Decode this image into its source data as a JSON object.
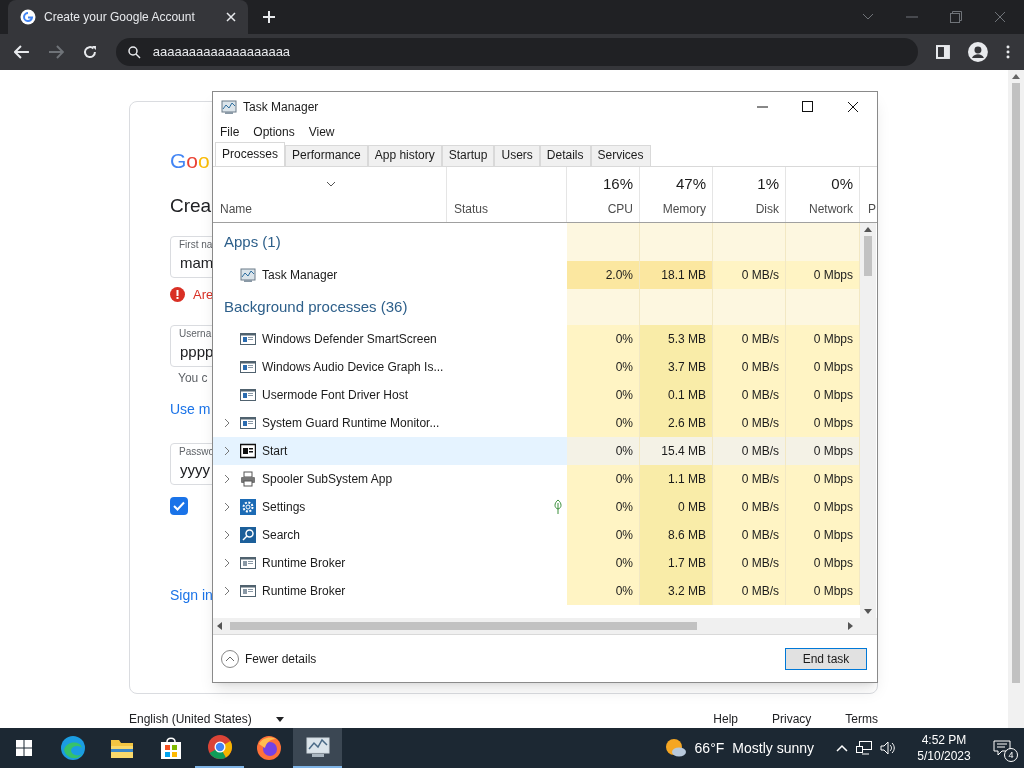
{
  "browser": {
    "tab": {
      "title": "Create your Google Account"
    },
    "address": "aaaaaaaaaaaaaaaaaaa"
  },
  "google_page": {
    "logo": "Goo",
    "heading": "Crea",
    "first_name": {
      "label": "First na",
      "value": "mam"
    },
    "error": "Are",
    "username": {
      "label": "Userna",
      "value": "pppp",
      "hint": "You c"
    },
    "link": "Use m",
    "password": {
      "label": "Passwo",
      "value": "yyyy"
    },
    "show_password": {
      "checked": true
    },
    "sign_in": "Sign in",
    "footer": [
      "English (United States)",
      "Help",
      "Privacy",
      "Terms"
    ]
  },
  "task_manager": {
    "title": "Task Manager",
    "menu": [
      "File",
      "Options",
      "View"
    ],
    "tabs": [
      {
        "label": "Processes",
        "selected": true
      },
      {
        "label": "Performance",
        "selected": false
      },
      {
        "label": "App history",
        "selected": false
      },
      {
        "label": "Startup",
        "selected": false
      },
      {
        "label": "Users",
        "selected": false
      },
      {
        "label": "Details",
        "selected": false
      },
      {
        "label": "Services",
        "selected": false
      }
    ],
    "columns": [
      {
        "label": "Name"
      },
      {
        "label": "Status"
      },
      {
        "percent": "16%",
        "label": "CPU"
      },
      {
        "percent": "47%",
        "label": "Memory"
      },
      {
        "percent": "1%",
        "label": "Disk"
      },
      {
        "percent": "0%",
        "label": "Network"
      },
      {
        "label": "P"
      }
    ],
    "groups": [
      {
        "title": "Apps (1)",
        "rows": [
          {
            "name": "Task Manager",
            "kind": "chart",
            "expandable": false,
            "hovered": false,
            "efficiency": false,
            "cpu": "2.0%",
            "memory": "18.1 MB",
            "disk": "0 MB/s",
            "network": "0 Mbps"
          }
        ]
      },
      {
        "title": "Background processes (36)",
        "rows": [
          {
            "name": "Windows Defender SmartScreen",
            "kind": "window",
            "expandable": false,
            "hovered": false,
            "efficiency": false,
            "cpu": "0%",
            "memory": "5.3 MB",
            "disk": "0 MB/s",
            "network": "0 Mbps"
          },
          {
            "name": "Windows Audio Device Graph Is...",
            "kind": "window",
            "expandable": false,
            "hovered": false,
            "efficiency": false,
            "cpu": "0%",
            "memory": "3.7 MB",
            "disk": "0 MB/s",
            "network": "0 Mbps"
          },
          {
            "name": "Usermode Font Driver Host",
            "kind": "window",
            "expandable": false,
            "hovered": false,
            "efficiency": false,
            "cpu": "0%",
            "memory": "0.1 MB",
            "disk": "0 MB/s",
            "network": "0 Mbps"
          },
          {
            "name": "System Guard Runtime Monitor...",
            "kind": "window",
            "expandable": true,
            "hovered": false,
            "efficiency": false,
            "cpu": "0%",
            "memory": "2.6 MB",
            "disk": "0 MB/s",
            "network": "0 Mbps"
          },
          {
            "name": "Start",
            "kind": "start",
            "expandable": true,
            "hovered": true,
            "efficiency": false,
            "cpu": "0%",
            "memory": "15.4 MB",
            "disk": "0 MB/s",
            "network": "0 Mbps"
          },
          {
            "name": "Spooler SubSystem App",
            "kind": "printer",
            "expandable": true,
            "hovered": false,
            "efficiency": false,
            "cpu": "0%",
            "memory": "1.1 MB",
            "disk": "0 MB/s",
            "network": "0 Mbps"
          },
          {
            "name": "Settings",
            "kind": "gear",
            "expandable": true,
            "hovered": false,
            "efficiency": true,
            "cpu": "0%",
            "memory": "0 MB",
            "disk": "0 MB/s",
            "network": "0 Mbps"
          },
          {
            "name": "Search",
            "kind": "search",
            "expandable": true,
            "hovered": false,
            "efficiency": false,
            "cpu": "0%",
            "memory": "8.6 MB",
            "disk": "0 MB/s",
            "network": "0 Mbps"
          },
          {
            "name": "Runtime Broker",
            "kind": "broker",
            "expandable": true,
            "hovered": false,
            "efficiency": false,
            "cpu": "0%",
            "memory": "1.7 MB",
            "disk": "0 MB/s",
            "network": "0 Mbps"
          },
          {
            "name": "Runtime Broker",
            "kind": "broker",
            "expandable": true,
            "hovered": false,
            "efficiency": false,
            "cpu": "0%",
            "memory": "3.2 MB",
            "disk": "0 MB/s",
            "network": "0 Mbps"
          }
        ]
      }
    ],
    "fewer_details": "Fewer details",
    "end_task": "End task"
  },
  "taskbar": {
    "apps": [
      {
        "kind": "edge",
        "active": false
      },
      {
        "kind": "folder",
        "active": false
      },
      {
        "kind": "store",
        "active": false
      },
      {
        "kind": "chrome",
        "active": true
      },
      {
        "kind": "firefox",
        "active": false
      },
      {
        "kind": "taskmgr",
        "active": true
      }
    ],
    "weather": {
      "temp": "66°F",
      "text": "Mostly sunny"
    },
    "time": "4:52 PM",
    "date": "5/10/2023",
    "notifications": "4"
  }
}
